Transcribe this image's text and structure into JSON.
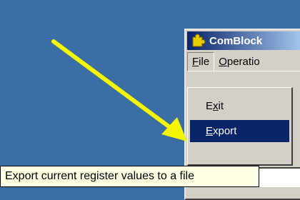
{
  "window": {
    "title": "ComBlock",
    "icon": "puzzle-piece-icon"
  },
  "menubar": {
    "file_label": "File",
    "operations_label": "Operatio"
  },
  "file_menu": {
    "items": [
      {
        "label": "Exit",
        "mnemonic": "x"
      },
      {
        "label": "Export",
        "mnemonic": "E"
      }
    ],
    "highlighted": "Export"
  },
  "tooltip": {
    "text": "Export current register values to a file"
  },
  "annotation": {
    "arrow_color": "#f5f500",
    "arrow_icon": "yellow-arrow-icon"
  }
}
